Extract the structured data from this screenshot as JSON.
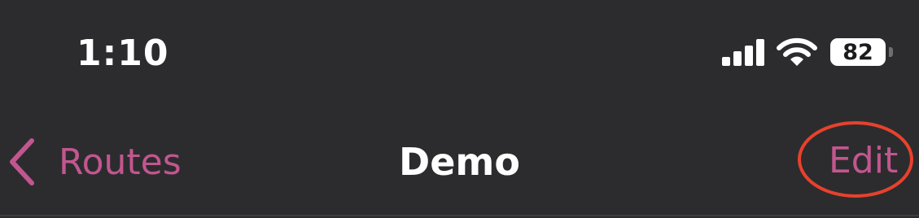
{
  "status_bar": {
    "time": "1:10",
    "battery_level": "82",
    "icons": [
      "cellular-signal-icon",
      "wifi-icon",
      "battery-icon"
    ]
  },
  "nav_bar": {
    "back_label": "Routes",
    "title": "Demo",
    "edit_label": "Edit"
  },
  "colors": {
    "background": "#2c2c2e",
    "accent": "#c2568f",
    "highlight_annotation": "#e8412c",
    "text_primary": "#ffffff"
  }
}
